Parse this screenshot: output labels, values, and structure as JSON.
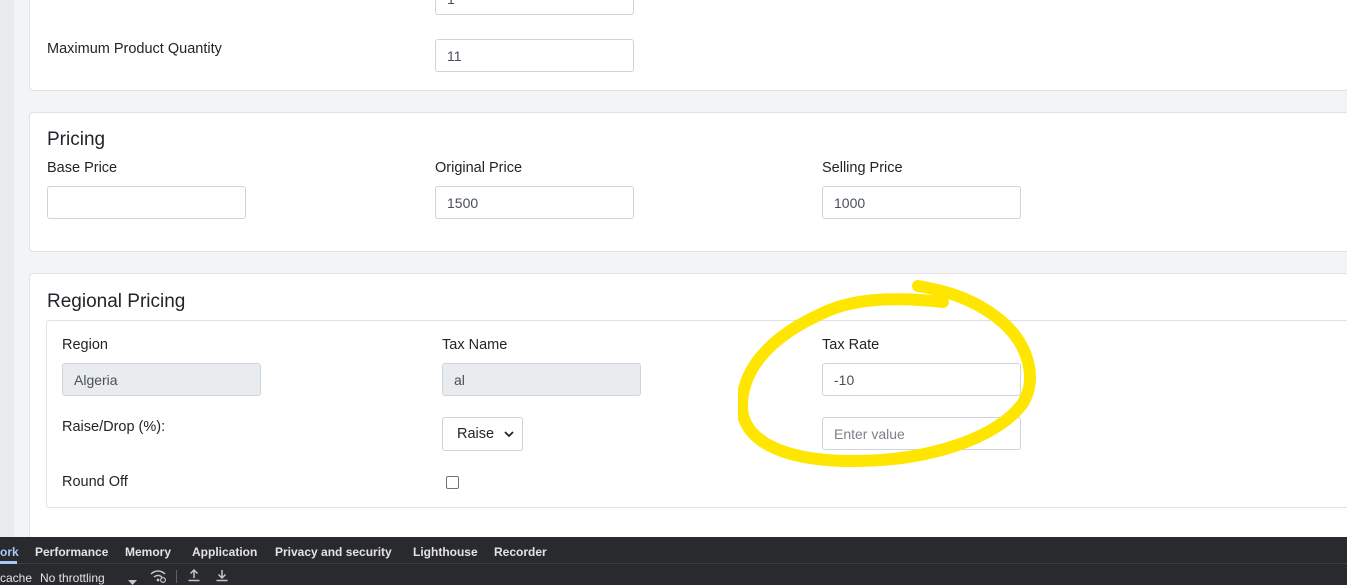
{
  "product_limits": {
    "max_quantity_label": "Maximum Product Quantity",
    "max_quantity_value": "11",
    "min_quantity_value": "1"
  },
  "pricing": {
    "title": "Pricing",
    "base_price_label": "Base Price",
    "base_price_value": "",
    "original_price_label": "Original Price",
    "original_price_value": "1500",
    "selling_price_label": "Selling Price",
    "selling_price_value": "1000"
  },
  "regional_pricing": {
    "title": "Regional Pricing",
    "region_label": "Region",
    "region_value": "Algeria",
    "tax_name_label": "Tax Name",
    "tax_name_value": "al",
    "tax_rate_label": "Tax Rate",
    "tax_rate_value": "-10",
    "raise_drop_label": "Raise/Drop (%):",
    "raise_drop_selected": "Raise",
    "value_placeholder": "Enter value",
    "round_off_label": "Round Off",
    "round_off_checked": false
  },
  "annotation": {
    "highlight_color": "#ffe600"
  },
  "devtools": {
    "tabs": [
      "ork",
      "Performance",
      "Memory",
      "Application",
      "Privacy and security",
      "Lighthouse",
      "Recorder"
    ],
    "active_tab": "ork",
    "toolbar_cache_text": "cache",
    "throttling_value": "No throttling"
  }
}
